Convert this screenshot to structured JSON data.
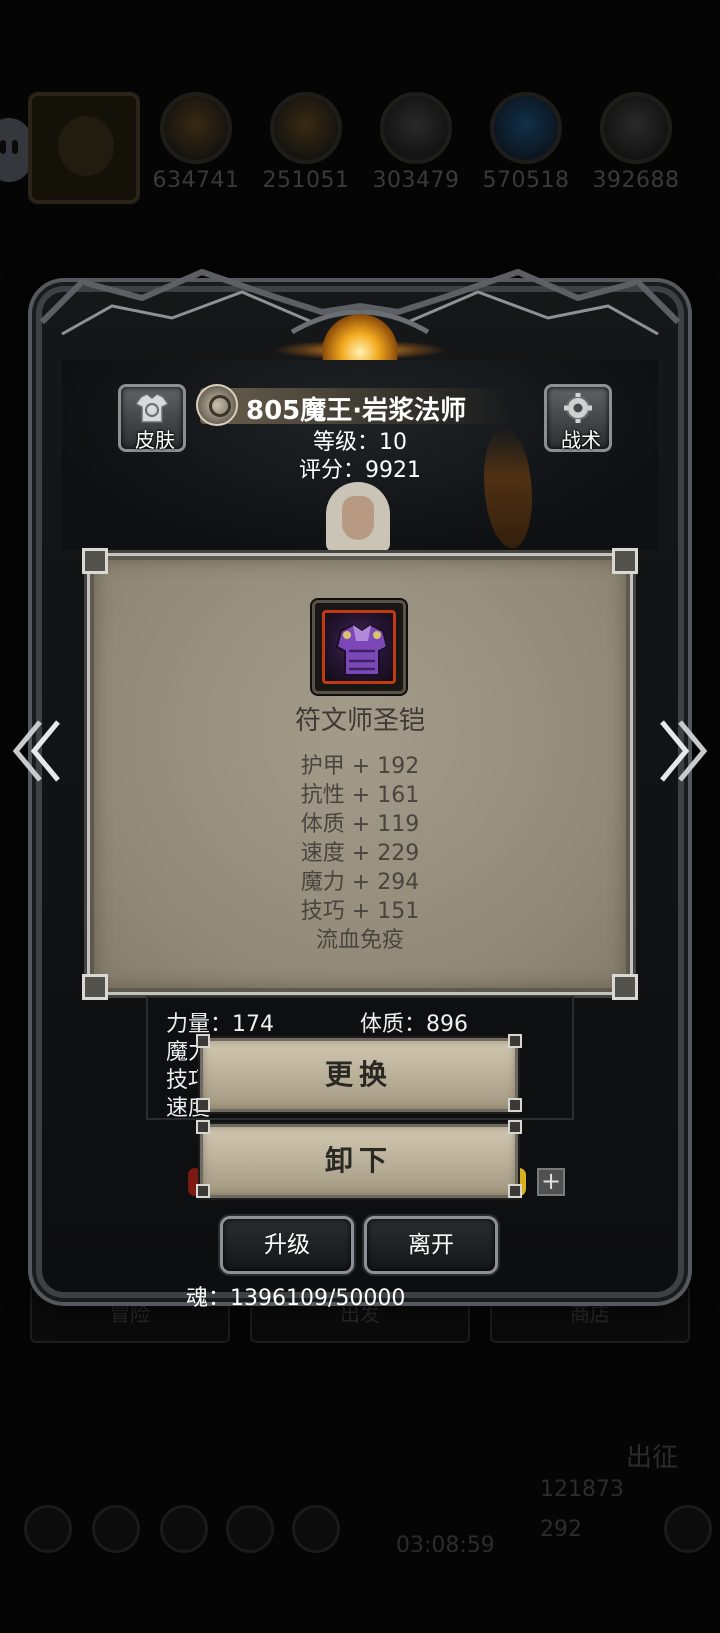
{
  "resources": [
    {
      "name": "coin-resource",
      "value": "634741",
      "icon": "copper-ore-icon"
    },
    {
      "name": "wood-resource",
      "value": "251051",
      "icon": "wood-icon"
    },
    {
      "name": "stone-resource",
      "value": "303479",
      "icon": "stone-icon"
    },
    {
      "name": "crystal-resource",
      "value": "570518",
      "icon": "crystal-icon"
    },
    {
      "name": "iron-resource",
      "value": "392688",
      "icon": "iron-icon"
    }
  ],
  "hero": {
    "name": "805魔王·岩浆法师",
    "level": "等级：10",
    "score": "评分：9921"
  },
  "skin_button": {
    "label": "皮肤",
    "icon": "shirt-swap-icon"
  },
  "tactics_button": {
    "label": "战术",
    "icon": "gear-icon"
  },
  "item": {
    "name": "符文师圣铠",
    "icon": "purple-armor-icon",
    "stats": [
      "护甲 + 192",
      "抗性 + 161",
      "体质 + 119",
      "速度 + 229",
      "魔力 + 294",
      "技巧 + 151",
      "流血免疫"
    ]
  },
  "attributes": {
    "strength": "力量：174",
    "constitution": "体质：896",
    "magic_partial": "魔力",
    "skill_partial": "技巧",
    "speed_partial": "速度"
  },
  "actions": {
    "replace": "更换",
    "unequip": "卸下",
    "upgrade": "升级",
    "leave": "离开"
  },
  "soul": "魂：1396109/50000",
  "background": {
    "bottom_tabs": [
      "冒险",
      "出发",
      "商店"
    ],
    "march": "出征",
    "gold": "121873",
    "gems": "292",
    "timer": "03:08:59"
  },
  "colors": {
    "accent_gold": "#f2a81e",
    "panel_parchment": "#9a9281",
    "button_parchment": "#c4baa3"
  }
}
